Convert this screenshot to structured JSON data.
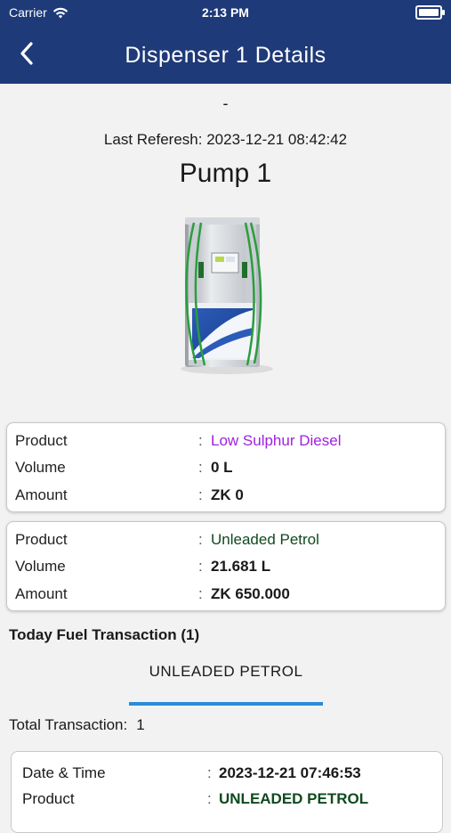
{
  "status": {
    "carrier": "Carrier",
    "time": "2:13 PM"
  },
  "nav": {
    "title": "Dispenser 1 Details"
  },
  "dash": "-",
  "refresh": {
    "label": "Last Referesh:",
    "value": "2023-12-21 08:42:42"
  },
  "pump": {
    "title": "Pump 1"
  },
  "products": [
    {
      "product_label": "Product",
      "product": "Low Sulphur Diesel",
      "volume_label": "Volume",
      "volume": "0 L",
      "amount_label": "Amount",
      "amount": "ZK 0",
      "color": "#a020e0"
    },
    {
      "product_label": "Product",
      "product": "Unleaded Petrol",
      "volume_label": "Volume",
      "volume": "21.681 L",
      "amount_label": "Amount",
      "amount": "ZK 650.000",
      "color": "#0f4a1e"
    }
  ],
  "colon": ":",
  "today": {
    "label": "Today Fuel Transaction (1)"
  },
  "tab": {
    "label": "UNLEADED PETROL",
    "accent": "#2b8bd8"
  },
  "total": {
    "label": "Total Transaction:",
    "count": "1"
  },
  "transaction": {
    "datetime_label": "Date & Time",
    "datetime": "2023-12-21 07:46:53",
    "product_label": "Product",
    "product": "UNLEADED PETROL"
  },
  "colors": {
    "header": "#1f3a78",
    "background": "#f2f2f2"
  }
}
